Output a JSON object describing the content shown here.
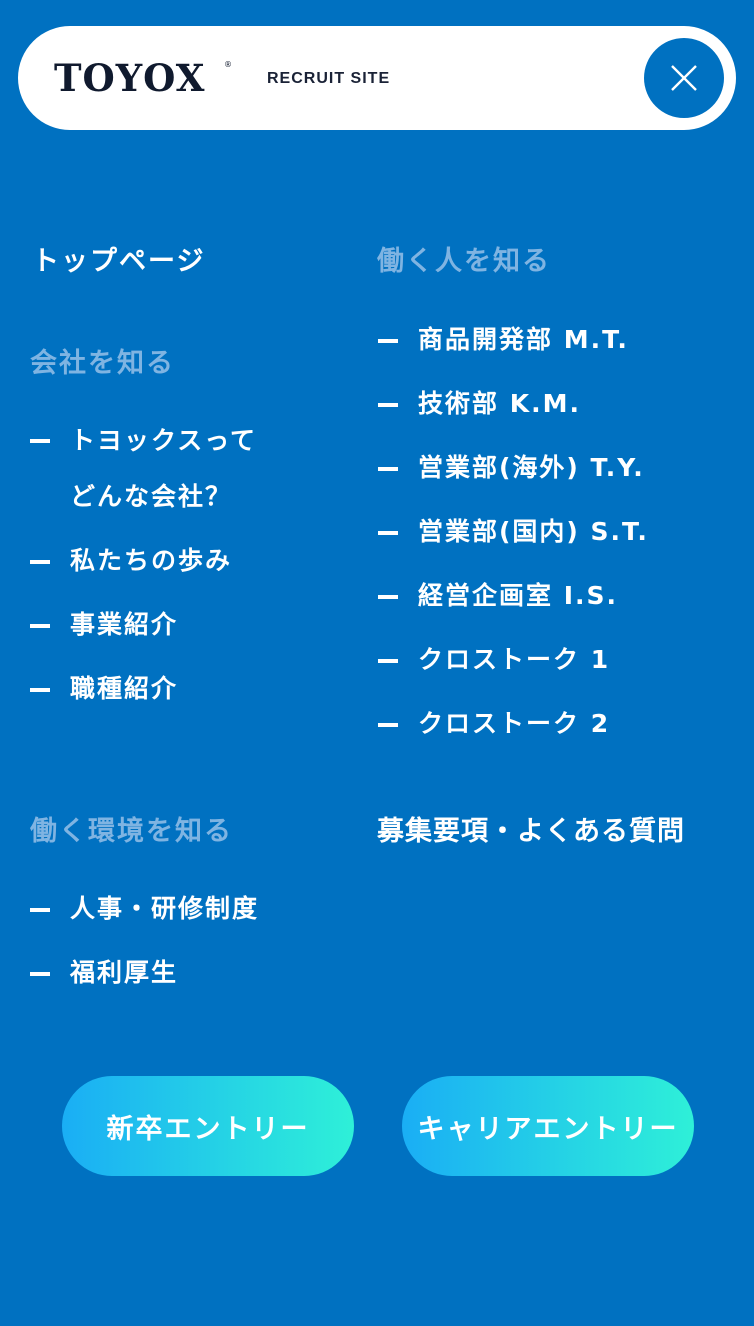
{
  "header": {
    "logo": "TOYOX",
    "logo_mark": "®",
    "subtitle": "RECRUIT SITE",
    "close_icon": "close-icon"
  },
  "nav": {
    "top_page": "トップページ",
    "company": {
      "heading": "会社を知る",
      "items": [
        "トヨックスって",
        "どんな会社？",
        "私たちの歩み",
        "事業紹介",
        "職種紹介"
      ]
    },
    "people": {
      "heading": "働く人を知る",
      "items": [
        "商品開発部 M.T.",
        "技術部 K.M.",
        "営業部(海外) T.Y.",
        "営業部(国内) S.T.",
        "経営企画室 I.S.",
        "クロストーク 1",
        "クロストーク 2"
      ]
    },
    "environment": {
      "heading": "働く環境を知る",
      "items": [
        "人事・研修制度",
        "福利厚生"
      ]
    },
    "jobs": "募集要項・よくある質問"
  },
  "buttons": {
    "new_grad": "新卒エントリー",
    "career": "キャリアエントリー"
  },
  "colors": {
    "background": "#0071c1",
    "muted_heading": "#7fb4e2",
    "button_gradient_start": "#1aaef5",
    "button_gradient_end": "#2ef0d8"
  }
}
